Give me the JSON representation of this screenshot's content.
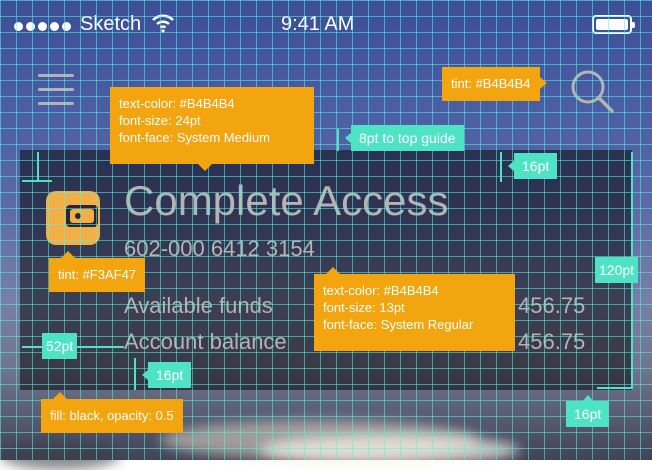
{
  "status_bar": {
    "carrier": "Sketch",
    "time": "9:41 AM",
    "signal_dots": 5,
    "icons": [
      "wifi-icon",
      "battery-icon"
    ]
  },
  "nav": {
    "menu_icon": "hamburger-icon",
    "search_icon": "search-icon"
  },
  "account": {
    "icon": "wallet-icon",
    "title": "Complete Access",
    "number": "602-000 6412 3154",
    "available_label": "Available funds",
    "available_value": "456.75",
    "balance_label": "Account balance",
    "balance_value": "456.75"
  },
  "annotations": {
    "tint_search": "tint: #B4B4B4",
    "title_spec": [
      "text-color: #B4B4B4",
      "font-size: 24pt",
      "font-face: System Medium"
    ],
    "top_guide": "8pt to top guide",
    "right_margin_16": "16pt",
    "height_120": "120pt",
    "tint_icon": "tint: #F3AF47",
    "body_spec": [
      "text-color: #B4B4B4",
      "font-size: 13pt",
      "font-face: System Regular"
    ],
    "left_52": "52pt",
    "bottom_16": "16pt",
    "fill_spec": "fill: black, opacity: 0.5",
    "right_bottom_16": "16pt"
  },
  "colors": {
    "text": "#B4B4B4",
    "accent": "#F3AF47",
    "annotation": "#F2A50F",
    "dimension": "#4FE3C6"
  }
}
